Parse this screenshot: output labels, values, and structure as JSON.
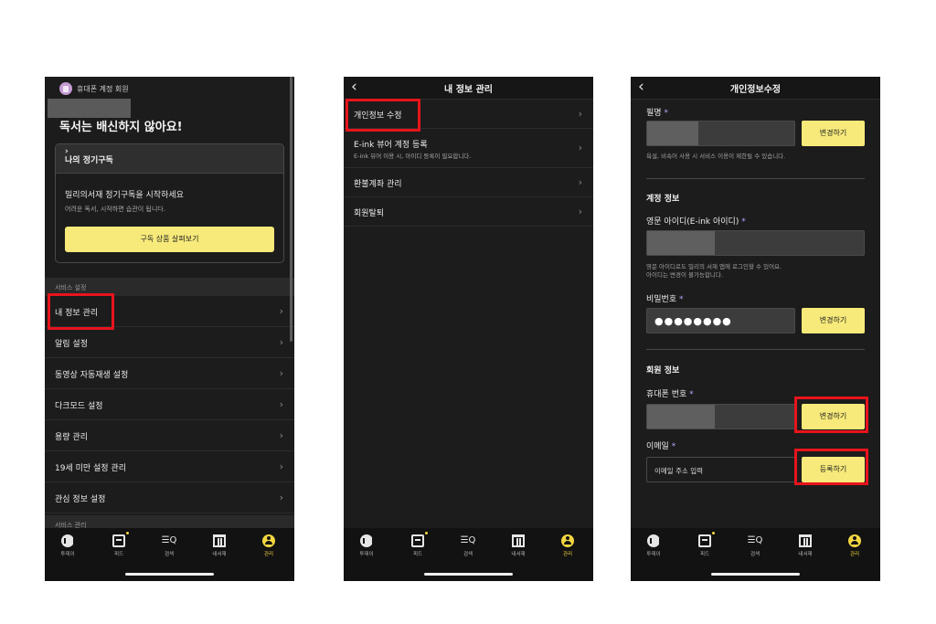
{
  "phone1": {
    "member_label": "휴대폰 계정 회원",
    "headline": "독서는 배신하지 않아요!",
    "subscription_card": {
      "title": "나의 정기구독",
      "line1": "밀리의서재 정기구독을 시작하세요",
      "line2": "어려운 독서, 시작하면 습관이 됩니다.",
      "button": "구독 상품 살펴보기"
    },
    "section_service_settings": "서비스 설정",
    "menu": [
      "내 정보 관리",
      "알림 설정",
      "동영상 자동재생 설정",
      "다크모드 설정",
      "용량 관리",
      "19세 미만 설정 관리",
      "관심 정보 설정"
    ],
    "section_service_management": "서비스 관리"
  },
  "phone2": {
    "title": "내 정보 관리",
    "items": {
      "edit_profile": "개인정보 수정",
      "eink": "E-ink 뷰어 계정 등록",
      "eink_sub": "E-ink 뷰어 이용 시, 아이디 등록이 필요합니다.",
      "refund": "환불계좌 관리",
      "withdraw": "회원탈퇴"
    }
  },
  "phone3": {
    "title": "개인정보수정",
    "pen_name_label": "필명",
    "pen_name_help": "욕설, 비속어 사용 시 서비스 이용이 제한될 수 있습니다.",
    "account_section": "계정 정보",
    "eng_id_label": "영문 아이디(E-ink 아이디)",
    "eng_id_help1": "영문 아이디로도 밀리의 서재 앱에 로그인할 수 있어요.",
    "eng_id_help2": "아이디는 변경이 불가능합니다.",
    "password_label": "비밀번호",
    "password_mask": "●●●●●●●●",
    "member_section": "회원 정보",
    "phone_label": "휴대폰 번호",
    "email_label": "이메일",
    "email_placeholder": "이메일 주소 입력",
    "required_mark": "*",
    "change_button": "변경하기",
    "register_button": "등록하기"
  },
  "tabbar": {
    "tabs": [
      "투데이",
      "피드",
      "검색",
      "내서재",
      "관리"
    ],
    "search_glyph": "☰Q"
  },
  "back_glyph": "‹",
  "chevron_glyph": "›",
  "colors": {
    "accent_yellow": "#f7ea7a",
    "highlight_red": "#e8141c",
    "background": "#1c1c1c"
  }
}
